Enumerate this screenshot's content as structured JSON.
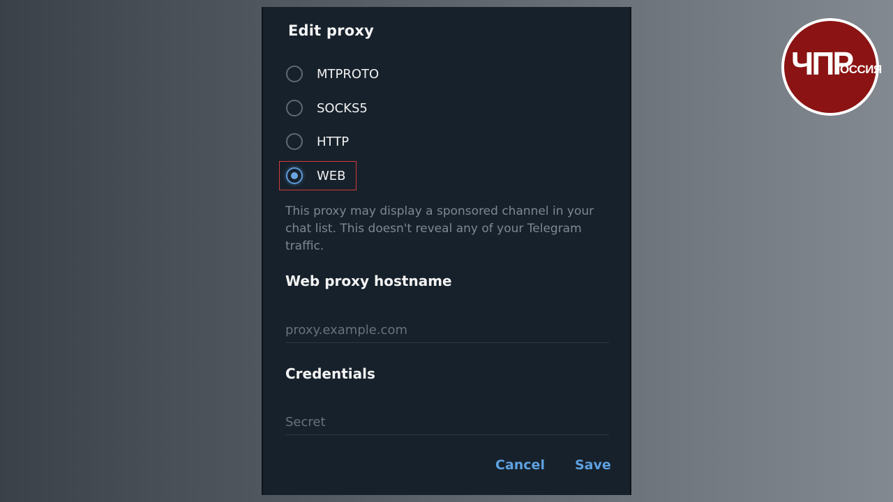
{
  "dialog": {
    "title": "Edit proxy",
    "proxy_types": [
      {
        "label": "MTPROTO",
        "checked": false
      },
      {
        "label": "SOCKS5",
        "checked": false
      },
      {
        "label": "HTTP",
        "checked": false
      },
      {
        "label": "WEB",
        "checked": true
      }
    ],
    "hint": "This proxy may display a sponsored channel in your chat list. This doesn't reveal any of your Telegram traffic.",
    "hostname_section": {
      "title": "Web proxy hostname",
      "placeholder": "proxy.example.com",
      "value": ""
    },
    "credentials_section": {
      "title": "Credentials",
      "placeholder": "Secret",
      "value": ""
    },
    "buttons": {
      "cancel": "Cancel",
      "save": "Save"
    }
  },
  "watermark": {
    "main": "ЧПР",
    "sub": "ОССИЯ"
  },
  "colors": {
    "dialog_bg": "#17212b",
    "accent": "#5ea1e0",
    "highlight_box": "#d23b3b",
    "logo_bg": "#8b1313"
  }
}
